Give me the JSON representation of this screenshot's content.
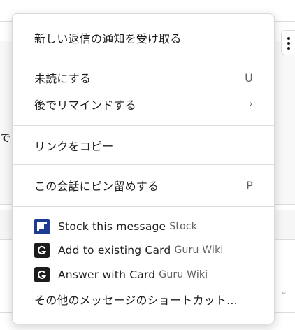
{
  "background": {
    "fragment_text": "で",
    "more_icon": "vertical-ellipsis-icon",
    "expand_icon": "chevron-down-icon"
  },
  "menu": {
    "follow_replies": "新しい返信の通知を受け取る",
    "mark_unread": {
      "label": "未読にする",
      "shortcut": "U"
    },
    "remind_later": {
      "label": "後でリマインドする",
      "submenu": "›"
    },
    "copy_link": "リンクをコピー",
    "pin": {
      "label": "この会話にピン留めする",
      "shortcut": "P"
    },
    "apps": [
      {
        "name": "Stock this message",
        "source": "Stock",
        "icon": "stock-app-icon"
      },
      {
        "name": "Add to existing Card",
        "source": "Guru Wiki",
        "icon": "guru-app-icon"
      },
      {
        "name": "Answer with Card",
        "source": "Guru Wiki",
        "icon": "guru-app-icon"
      }
    ],
    "more_shortcuts": "その他のメッセージのショートカット..."
  }
}
